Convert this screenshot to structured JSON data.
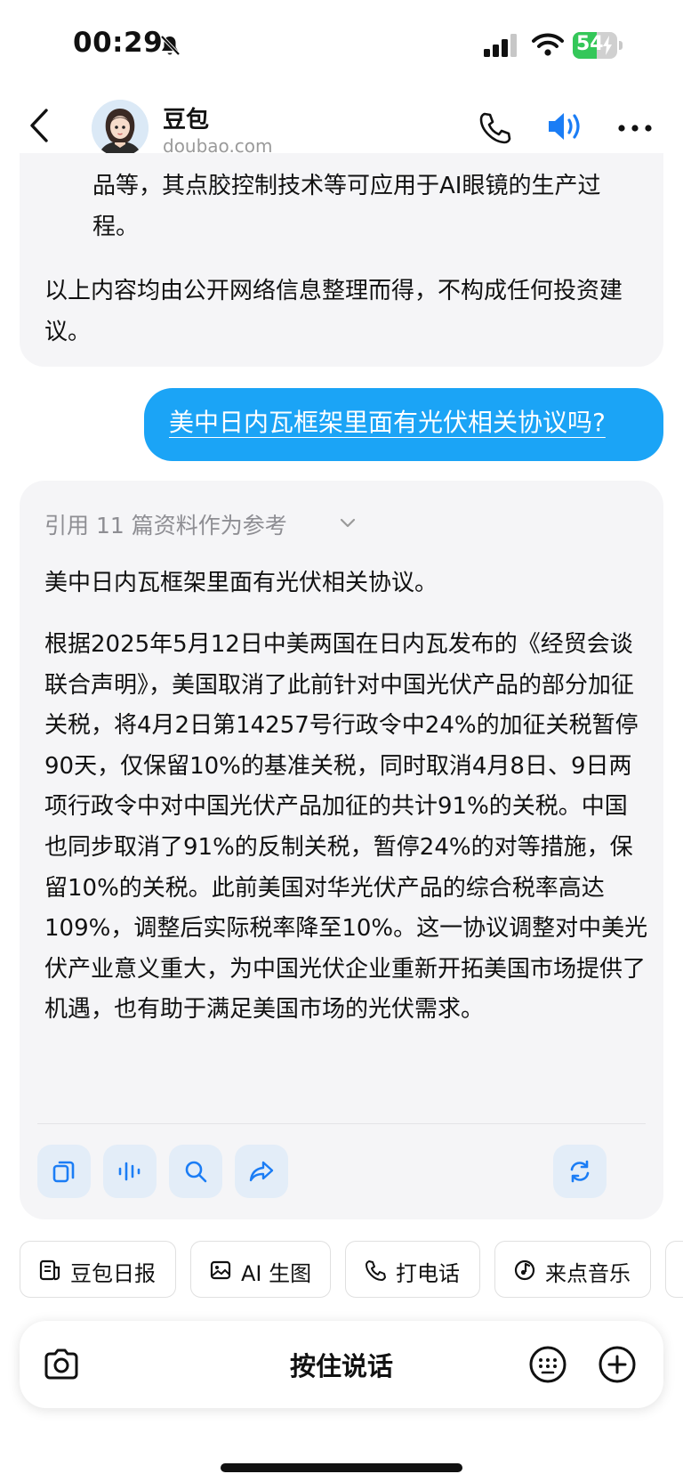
{
  "status_bar": {
    "time": "00:29",
    "battery": "54",
    "battery_level": 0.54
  },
  "header": {
    "name": "豆包",
    "domain": "doubao.com"
  },
  "previous_message": {
    "bullet_tail": "品等，其点胶控制技术等可应用于AI眼镜的生产过程。",
    "disclaimer": "以上内容均由公开网络信息整理而得，不构成任何投资建议。"
  },
  "user_message": "美中日内瓦框架里面有光伏相关协议吗?",
  "ai_message": {
    "references": "引用 11 篇资料作为参考",
    "summary": "美中日内瓦框架里面有光伏相关协议。",
    "body": "根据2025年5月12日中美两国在日内瓦发布的《经贸会谈联合声明》，美国取消了此前针对中国光伏产品的部分加征关税，将4月2日第14257号行政令中24%的加征关税暂停90天，仅保留10%的基准关税，同时取消4月8日、9日两项行政令中对中国光伏产品加征的共计91%的关税。中国也同步取消了91%的反制关税，暂停24%的对等措施，保留10%的关税。此前美国对华光伏产品的综合税率高达109%，调整后实际税率降至10%。这一协议调整对中美光伏产业意义重大，为中国光伏企业重新开拓美国市场提供了机遇，也有助于满足美国市场的光伏需求。",
    "actions": [
      "copy-icon",
      "voice-wave-icon",
      "search-icon",
      "share-icon",
      "regenerate-icon"
    ]
  },
  "quick_actions": [
    {
      "label": "豆包日报",
      "icon": "daily-report-icon"
    },
    {
      "label": "AI 生图",
      "icon": "image-icon"
    },
    {
      "label": "打电话",
      "icon": "phone-icon"
    },
    {
      "label": "来点音乐",
      "icon": "music-icon"
    }
  ],
  "input_bar": {
    "hold_to_talk": "按住说话"
  },
  "colors": {
    "accent": "#1ba4f6",
    "bubble_bg": "#f5f5f7",
    "action_bg": "#e3edf8",
    "battery_green": "#34c759"
  }
}
